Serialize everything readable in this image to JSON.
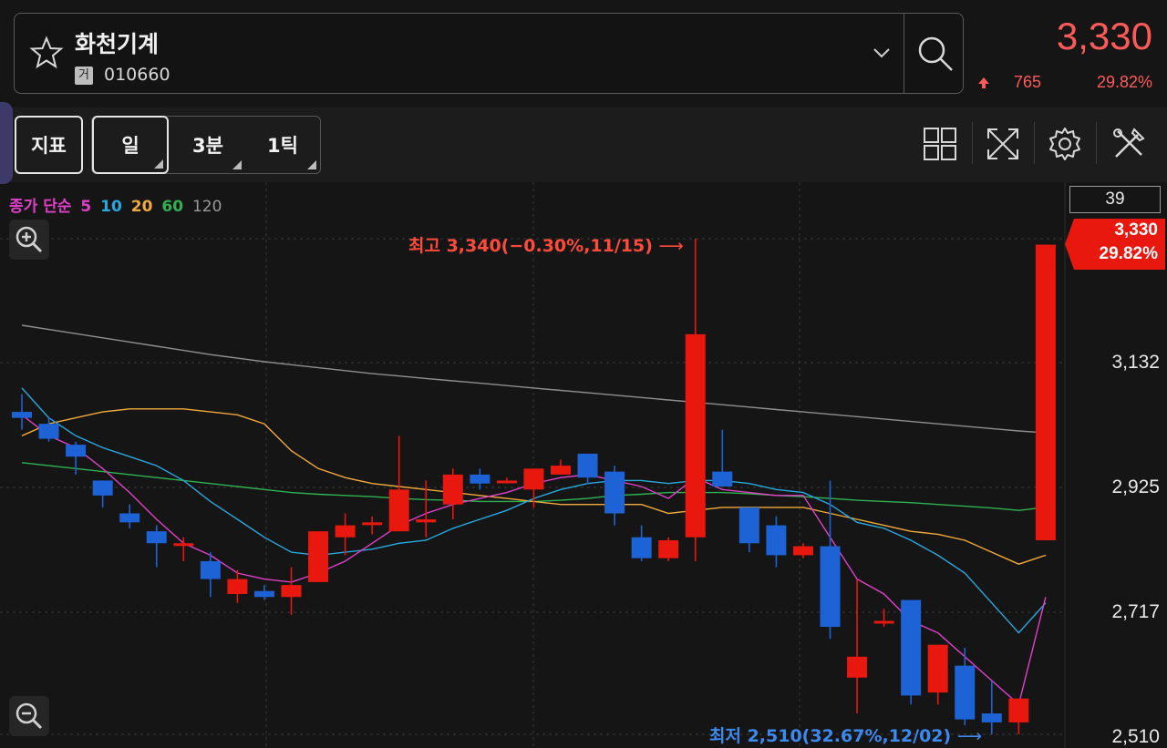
{
  "header": {
    "stock_name": "화천기계",
    "market_badge": "거",
    "stock_code": "010660",
    "current_price": "3,330",
    "change": "765",
    "change_rate": "29.82%"
  },
  "toolbar": {
    "indicator_label": "지표",
    "periods": [
      {
        "label": "일",
        "selected": true
      },
      {
        "label": "3분",
        "selected": false
      },
      {
        "label": "1틱",
        "selected": false
      }
    ],
    "icons": [
      "layout-grid-icon",
      "fullscreen-icon",
      "settings-gear-icon",
      "tools-icon"
    ]
  },
  "legend": {
    "prefix": "종가 단순",
    "periods": [
      {
        "label": "5",
        "color": "#e040c8"
      },
      {
        "label": "10",
        "color": "#29a8e0"
      },
      {
        "label": "20",
        "color": "#f2a93b"
      },
      {
        "label": "60",
        "color": "#2fb350"
      },
      {
        "label": "120",
        "color": "#9a9a9a"
      }
    ]
  },
  "axis": {
    "top_box": "39",
    "current_tag_price": "3,330",
    "current_tag_rate": "29.82%",
    "ticks": [
      "3,132",
      "2,925",
      "2,717",
      "2,510"
    ]
  },
  "annotations": {
    "high": "최고 3,340(−0.30%,11/15)",
    "low": "최저 2,510(32.67%,12/02)"
  },
  "colors": {
    "up": "#e8180e",
    "down": "#1e63d6",
    "accent": "#ff5a5a"
  },
  "chart_data": {
    "type": "candlestick",
    "y_range": [
      2510,
      3340
    ],
    "candles": [
      {
        "o": 3050,
        "h": 3080,
        "l": 3020,
        "c": 3040
      },
      {
        "o": 3030,
        "h": 3040,
        "l": 3000,
        "c": 3005
      },
      {
        "o": 2995,
        "h": 3000,
        "l": 2945,
        "c": 2975
      },
      {
        "o": 2935,
        "h": 2935,
        "l": 2890,
        "c": 2910
      },
      {
        "o": 2880,
        "h": 2895,
        "l": 2855,
        "c": 2865
      },
      {
        "o": 2850,
        "h": 2860,
        "l": 2790,
        "c": 2830
      },
      {
        "o": 2830,
        "h": 2840,
        "l": 2800,
        "c": 2830
      },
      {
        "o": 2800,
        "h": 2815,
        "l": 2740,
        "c": 2770
      },
      {
        "o": 2745,
        "h": 2785,
        "l": 2730,
        "c": 2770
      },
      {
        "o": 2750,
        "h": 2760,
        "l": 2735,
        "c": 2740
      },
      {
        "o": 2740,
        "h": 2790,
        "l": 2710,
        "c": 2760
      },
      {
        "o": 2765,
        "h": 2850,
        "l": 2765,
        "c": 2850
      },
      {
        "o": 2840,
        "h": 2880,
        "l": 2810,
        "c": 2860
      },
      {
        "o": 2865,
        "h": 2875,
        "l": 2845,
        "c": 2865
      },
      {
        "o": 2850,
        "h": 3010,
        "l": 2850,
        "c": 2920
      },
      {
        "o": 2865,
        "h": 2935,
        "l": 2840,
        "c": 2870
      },
      {
        "o": 2895,
        "h": 2955,
        "l": 2870,
        "c": 2945
      },
      {
        "o": 2945,
        "h": 2955,
        "l": 2920,
        "c": 2930
      },
      {
        "o": 2935,
        "h": 2940,
        "l": 2930,
        "c": 2935
      },
      {
        "o": 2920,
        "h": 2955,
        "l": 2890,
        "c": 2955
      },
      {
        "o": 2945,
        "h": 2970,
        "l": 2945,
        "c": 2960
      },
      {
        "o": 2980,
        "h": 2980,
        "l": 2930,
        "c": 2940
      },
      {
        "o": 2950,
        "h": 2960,
        "l": 2860,
        "c": 2880
      },
      {
        "o": 2840,
        "h": 2860,
        "l": 2800,
        "c": 2805
      },
      {
        "o": 2805,
        "h": 2840,
        "l": 2800,
        "c": 2835
      },
      {
        "o": 2840,
        "h": 3340,
        "l": 2800,
        "c": 3180
      },
      {
        "o": 2950,
        "h": 3020,
        "l": 2925,
        "c": 2925
      },
      {
        "o": 2890,
        "h": 2890,
        "l": 2815,
        "c": 2830
      },
      {
        "o": 2860,
        "h": 2875,
        "l": 2790,
        "c": 2810
      },
      {
        "o": 2810,
        "h": 2830,
        "l": 2805,
        "c": 2825
      },
      {
        "o": 2825,
        "h": 2935,
        "l": 2670,
        "c": 2690
      },
      {
        "o": 2605,
        "h": 2770,
        "l": 2545,
        "c": 2640
      },
      {
        "o": 2700,
        "h": 2720,
        "l": 2690,
        "c": 2700
      },
      {
        "o": 2735,
        "h": 2735,
        "l": 2560,
        "c": 2575
      },
      {
        "o": 2580,
        "h": 2610,
        "l": 2560,
        "c": 2660
      },
      {
        "o": 2625,
        "h": 2655,
        "l": 2525,
        "c": 2535
      },
      {
        "o": 2545,
        "h": 2600,
        "l": 2510,
        "c": 2530
      },
      {
        "o": 2530,
        "h": 2560,
        "l": 2510,
        "c": 2570
      },
      {
        "o": 2835,
        "h": 3330,
        "l": 2835,
        "c": 3330
      }
    ],
    "ma5": [
      3045,
      3010,
      2990,
      2955,
      2915,
      2870,
      2830,
      2810,
      2780,
      2770,
      2765,
      2780,
      2800,
      2830,
      2860,
      2880,
      2895,
      2905,
      2915,
      2930,
      2940,
      2945,
      2935,
      2925,
      2905,
      2940,
      2920,
      2915,
      2910,
      2910,
      2840,
      2770,
      2745,
      2700,
      2680,
      2640,
      2600,
      2560,
      2740
    ],
    "ma10": [
      3090,
      3040,
      3010,
      2990,
      2975,
      2960,
      2935,
      2900,
      2870,
      2840,
      2815,
      2810,
      2815,
      2820,
      2830,
      2835,
      2855,
      2870,
      2885,
      2905,
      2920,
      2930,
      2935,
      2935,
      2930,
      2935,
      2935,
      2930,
      2920,
      2915,
      2895,
      2865,
      2855,
      2835,
      2810,
      2780,
      2730,
      2680,
      2730
    ],
    "ma20": [
      3010,
      3030,
      3040,
      3050,
      3055,
      3055,
      3055,
      3050,
      3045,
      3030,
      2985,
      2955,
      2940,
      2930,
      2925,
      2920,
      2915,
      2910,
      2905,
      2900,
      2895,
      2895,
      2895,
      2895,
      2880,
      2885,
      2890,
      2890,
      2890,
      2890,
      2880,
      2870,
      2860,
      2850,
      2845,
      2835,
      2815,
      2795,
      2810
    ],
    "ma60": [
      2965,
      2960,
      2955,
      2950,
      2945,
      2940,
      2935,
      2930,
      2925,
      2920,
      2915,
      2912,
      2910,
      2908,
      2905,
      2903,
      2902,
      2900,
      2900,
      2900,
      2902,
      2905,
      2910,
      2912,
      2915,
      2915,
      2915,
      2913,
      2910,
      2908,
      2905,
      2902,
      2900,
      2898,
      2895,
      2892,
      2889,
      2885,
      2890
    ],
    "ma120": [
      3195,
      3188,
      3181,
      3174,
      3167,
      3160,
      3153,
      3146,
      3140,
      3134,
      3129,
      3124,
      3119,
      3114,
      3110,
      3106,
      3102,
      3098,
      3094,
      3090,
      3086,
      3082,
      3078,
      3074,
      3070,
      3066,
      3062,
      3058,
      3054,
      3050,
      3046,
      3042,
      3038,
      3034,
      3030,
      3026,
      3022,
      3018,
      3015
    ]
  }
}
